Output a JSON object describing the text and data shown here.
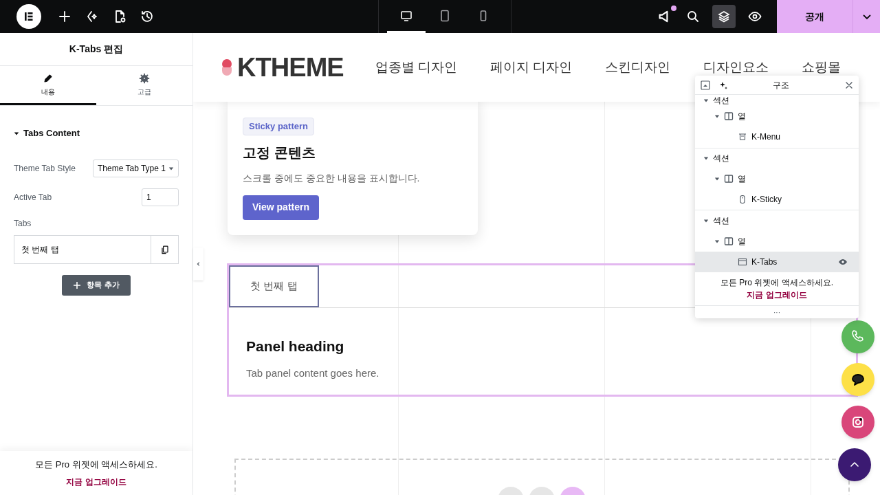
{
  "topbar": {
    "devices": [
      {
        "kind": "desktop",
        "selected": true
      },
      {
        "kind": "tablet",
        "selected": false
      },
      {
        "kind": "mobile",
        "selected": false
      }
    ],
    "publish": "공개"
  },
  "editor": {
    "title": "K-Tabs 편집",
    "tabs": [
      {
        "label": "내용",
        "kind": "pencil",
        "selected": true
      },
      {
        "label": "고급",
        "kind": "gear",
        "selected": false
      }
    ],
    "section": "Tabs Content",
    "expanded": true,
    "fields": [
      {
        "kind": "select",
        "label": "Theme Tab Style",
        "value": "Theme Tab Type 1"
      },
      {
        "kind": "number",
        "label": "Active Tab",
        "value": "1"
      }
    ],
    "repeater_label": "Tabs",
    "repeater_items": [
      "첫 번째 탭"
    ],
    "add_button": "항목 추가",
    "promo": {
      "text": "모든 Pro 위젯에 액세스하세요.",
      "link": "지금 업그레이드"
    }
  },
  "site": {
    "logo": "KTHEME",
    "menu": [
      "업종별 디자인",
      "페이지 디자인",
      "스킨디자인",
      "디자인요소",
      "쇼핑몰"
    ]
  },
  "sticky_card": {
    "tag": "Sticky pattern",
    "title": "고정 콘텐츠",
    "text": "스크롤 중에도 중요한 내용을 표시합니다.",
    "button": "View pattern"
  },
  "tabs_widget": {
    "tabs": [
      {
        "label": "첫 번째 탭",
        "selected": true
      }
    ],
    "heading": "Panel heading",
    "text": "Tab panel content goes here."
  },
  "navigator": {
    "title": "구조",
    "tree": [
      {
        "label": "섹션",
        "expanded": true,
        "selected": false,
        "children": [
          {
            "label": "열",
            "kind": "column",
            "expanded": true,
            "selected": false,
            "children": [
              {
                "label": "K-Menu",
                "kind": "menu",
                "selected": false
              }
            ]
          }
        ]
      },
      {
        "label": "섹션",
        "expanded": true,
        "selected": false,
        "children": [
          {
            "label": "열",
            "kind": "column",
            "expanded": true,
            "selected": false,
            "children": [
              {
                "label": "K-Sticky",
                "kind": "sticky",
                "selected": false
              }
            ]
          }
        ]
      },
      {
        "label": "섹션",
        "expanded": true,
        "selected": false,
        "children": [
          {
            "label": "열",
            "kind": "column",
            "expanded": true,
            "selected": false,
            "children": [
              {
                "label": "K-Tabs",
                "kind": "tabs",
                "selected": true
              }
            ]
          }
        ]
      }
    ],
    "promo": {
      "text": "모든 Pro 위젯에 액세스하세요.",
      "link": "지금 업그레이드"
    },
    "more": "···"
  },
  "floating": [
    {
      "kind": "phone",
      "color": "#5cb85c"
    },
    {
      "kind": "chat",
      "color": "#fde047"
    },
    {
      "kind": "instagram",
      "color": "#d9467a"
    },
    {
      "kind": "top",
      "color": "#3b1a72"
    }
  ]
}
